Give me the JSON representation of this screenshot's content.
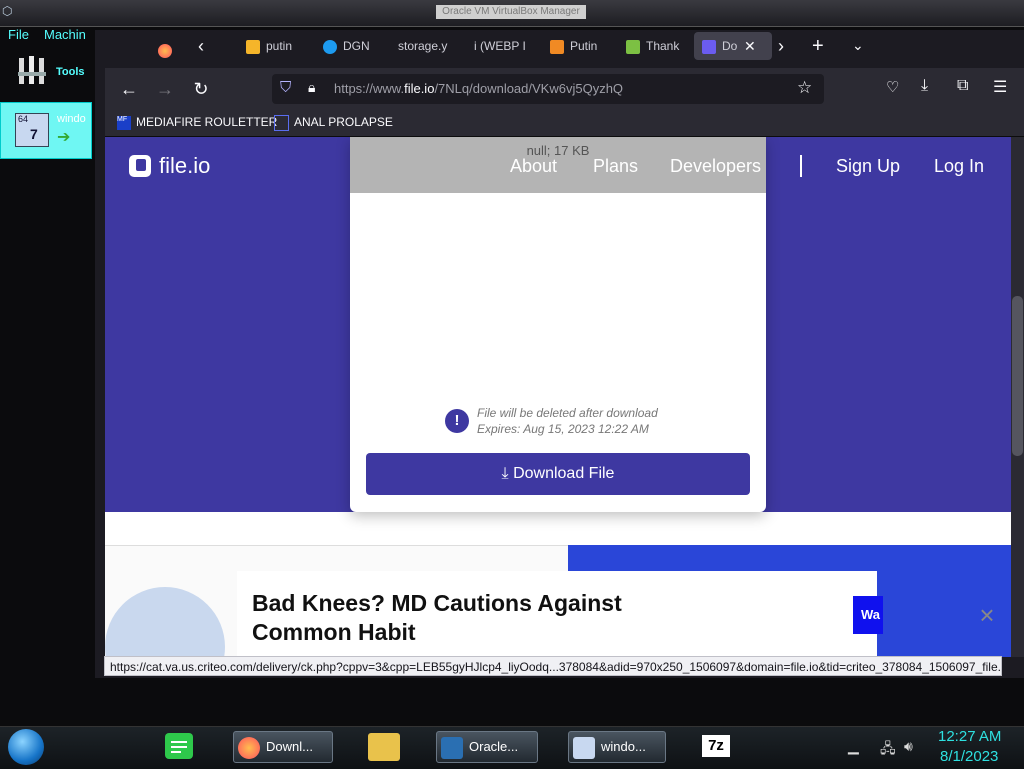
{
  "vbox": {
    "title": "Oracle VM VirtualBox Manager",
    "menu": [
      "File",
      "Machin"
    ],
    "tools_label": "Tools",
    "vm_label": "windo"
  },
  "browser": {
    "tabs": [
      {
        "label": "",
        "icon": "firefox-icon"
      },
      {
        "label": "putin",
        "icon": "image-icon"
      },
      {
        "label": "DGN",
        "icon": "twitter-icon"
      },
      {
        "label": "storage.y",
        "icon": ""
      },
      {
        "label": "i (WEBP I",
        "icon": ""
      },
      {
        "label": "Putin",
        "icon": "orange-icon"
      },
      {
        "label": "Thank",
        "icon": "leaf-icon"
      },
      {
        "label": "Do",
        "icon": "fileio-icon",
        "active": true
      }
    ],
    "url": {
      "prefix": "https://www.",
      "host": "file.io",
      "path": "/7NLq/download/VKw6vj5QyzhQ"
    },
    "bookmarks": [
      "MEDIAFIRE ROULETTER",
      "ANAL PROLAPSE"
    ],
    "status_url": "https://cat.va.us.criteo.com/delivery/ck.php?cppv=3&cpp=LEB55gyHJlcp4_liyOodq...378084&adid=970x250_1506097&domain=file.io&tid=criteo_378084_1506097_file.io"
  },
  "page": {
    "logo_text": "file.io",
    "nav": [
      "About",
      "Plans",
      "Developers",
      "Sign Up",
      "Log In"
    ],
    "file_meta": "null; 17 KB",
    "info_line1": "File will be deleted after download",
    "info_line2": "Expires: Aug 15, 2023 12:22 AM",
    "download_label": "Download File",
    "ad_title": "Bad Knees? MD Cautions Against Common Habit",
    "ad_button": "Wa"
  },
  "taskbar": {
    "items": [
      "Downl...",
      "Oracle...",
      "windo..."
    ],
    "time": "12:27 AM",
    "date": "8/1/2023"
  },
  "colors": {
    "brand": "#3e38a1",
    "clock": "#2ee0e0"
  }
}
